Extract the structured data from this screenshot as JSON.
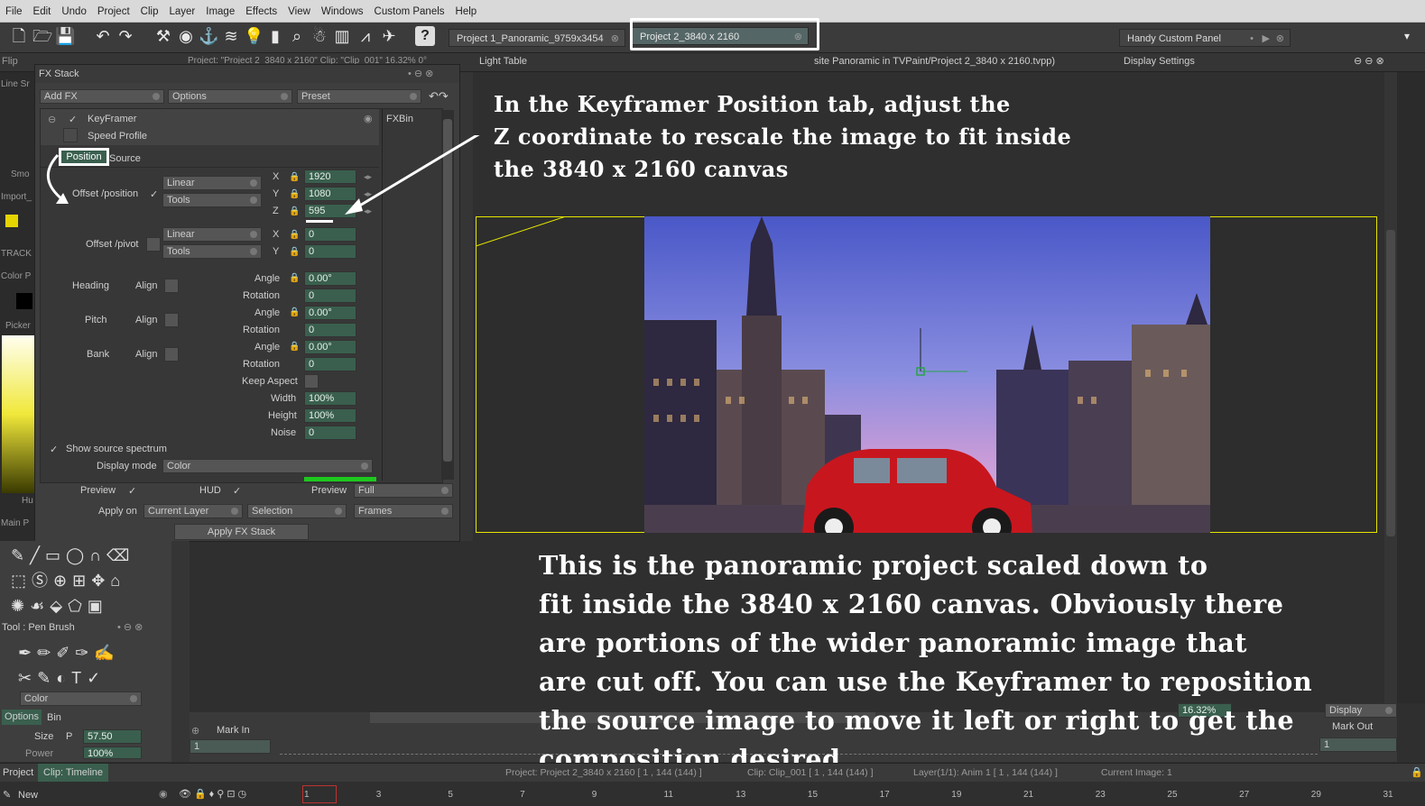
{
  "menubar": [
    "File",
    "Edit",
    "Undo",
    "Project",
    "Clip",
    "Layer",
    "Image",
    "Effects",
    "View",
    "Windows",
    "Custom Panels",
    "Help"
  ],
  "tabs": {
    "project1": "Project 1_Panoramic_9759x3454",
    "project2": "Project 2_3840 x 2160",
    "handy": "Handy Custom Panel"
  },
  "row2": {
    "flip": "Flip",
    "project_info": "Project: \"Project 2_3840 x 2160\"  Clip: \"Clip_001\"  16.32%  0°",
    "light_table": "Light Table",
    "file_path": "site Panoramic in TVPaint/Project 2_3840 x 2160.tvpp)",
    "display_settings": "Display Settings"
  },
  "left_strip": [
    "Line Sr",
    "Smo",
    "Import_",
    "TRACK",
    "Color P",
    "Picker",
    "Hu",
    "Main P"
  ],
  "fx": {
    "title": "FX Stack",
    "add_fx": "Add FX",
    "options": "Options",
    "preset": "Preset",
    "keyframer": "KeyFramer",
    "fxbin": "FXBin",
    "speed_profile": "Speed Profile",
    "tab_position": "Position",
    "tab_source": "Source",
    "offset_position": "Offset /position",
    "linear": "Linear",
    "tools": "Tools",
    "x_label": "X",
    "y_label": "Y",
    "z_label": "Z",
    "pos_x": "1920",
    "pos_y": "1080",
    "pos_z": "595",
    "offset_pivot": "Offset /pivot",
    "pivot_x": "0",
    "pivot_y": "0",
    "heading": "Heading",
    "pitch": "Pitch",
    "bank": "Bank",
    "align": "Align",
    "angle": "Angle",
    "rotation": "Rotation",
    "heading_angle": "0.00°",
    "heading_rot": "0",
    "pitch_angle": "0.00°",
    "pitch_rot": "0",
    "bank_angle": "0.00°",
    "bank_rot": "0",
    "keep_aspect": "Keep Aspect",
    "width": "Width",
    "width_val": "100%",
    "height": "Height",
    "height_val": "100%",
    "noise": "Noise",
    "noise_val": "0",
    "show_source": "Show source spectrum",
    "display_mode": "Display mode",
    "display_mode_val": "Color",
    "preview": "Preview",
    "hud": "HUD",
    "preview2": "Preview",
    "full": "Full",
    "apply_on": "Apply on",
    "current_layer": "Current Layer",
    "selection": "Selection",
    "frames": "Frames",
    "apply_btn": "Apply FX Stack"
  },
  "tool": {
    "title": "Tool : Pen Brush",
    "color": "Color",
    "options": "Options",
    "bin": "Bin",
    "size": "Size",
    "p": "P",
    "size_val": "57.50",
    "power": "Power",
    "power_val": "100%"
  },
  "timeline": {
    "mark_in": "Mark In",
    "mark_out": "Mark Out",
    "in_val": "1",
    "out_val": "1",
    "zoom": "16.32%",
    "display": "Display",
    "project_tab": "Project",
    "clip_tab": "Clip: Timeline",
    "status_project": "Project: Project 2_3840 x 2160 [ 1 , 144  (144) ]",
    "status_clip": "Clip: Clip_001 [ 1 , 144  (144) ]",
    "status_layer": "Layer(1/1): Anim 1 [ 1 , 144  (144) ]",
    "status_image": "Current Image: 1",
    "new": "New",
    "frame_numbers": [
      "1",
      "3",
      "5",
      "7",
      "9",
      "11",
      "13",
      "15",
      "17",
      "19",
      "21",
      "23",
      "25",
      "27",
      "29",
      "31"
    ]
  },
  "annotations": {
    "top": [
      "In the Keyframer Position tab, adjust the",
      "Z coordinate to rescale the image to fit inside",
      "the 3840 x 2160 canvas"
    ],
    "bottom": [
      "This is the panoramic project scaled down to",
      "fit inside the 3840 x 2160 canvas. Obviously there",
      "are portions of the wider panoramic image that",
      "are cut off.  You can use the Keyframer to reposition",
      "the source image to move it left or right to get the",
      "composition desired ."
    ]
  },
  "colors": {
    "accent_green": "#3a5f4e",
    "canvas_border": "#e6e600",
    "annotation_outline": "#ffffff"
  }
}
